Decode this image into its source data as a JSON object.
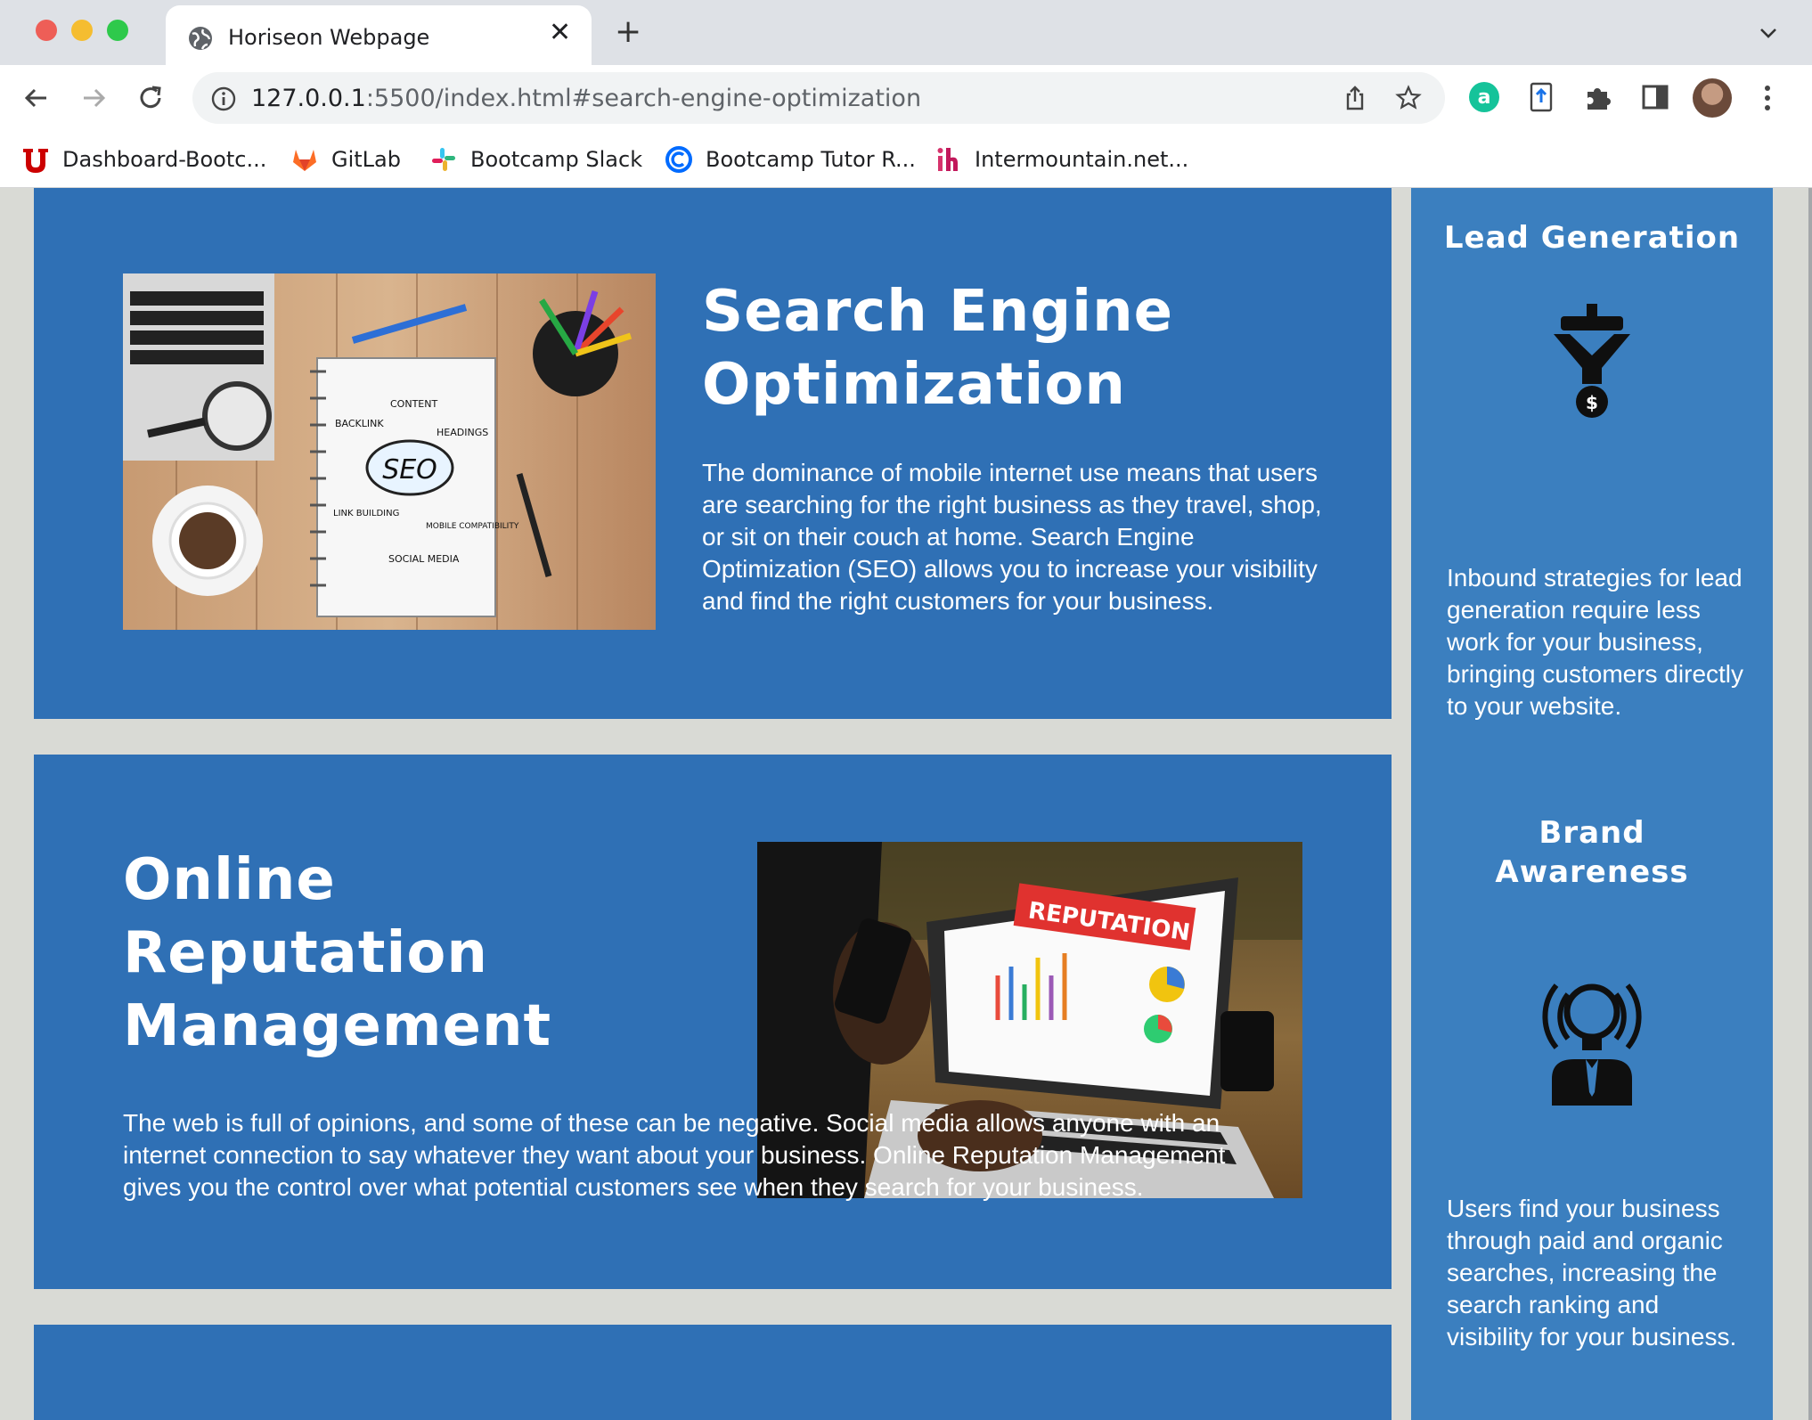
{
  "browser": {
    "tab_title": "Horiseon Webpage",
    "url_host": "127.0.0.1",
    "url_rest": ":5500/index.html#search-engine-optimization",
    "bookmarks": [
      {
        "label": "Dashboard-Bootc...",
        "icon": "university-logo-icon"
      },
      {
        "label": "GitLab",
        "icon": "gitlab-icon"
      },
      {
        "label": "Bootcamp Slack",
        "icon": "slack-icon"
      },
      {
        "label": "Bootcamp Tutor R...",
        "icon": "calendly-icon"
      },
      {
        "label": "Intermountain.net...",
        "icon": "intermountain-icon"
      }
    ]
  },
  "sections": {
    "seo": {
      "title": "Search Engine Optimization",
      "text": "The dominance of mobile internet use means that users are searching for the right business as they travel, shop, or sit on their couch at home. Search Engine Optimization (SEO) allows you to increase your visibility and find the right customers for your business.",
      "image_labels": {
        "center": "SEO",
        "content": "CONTENT",
        "backlink": "BACKLINK",
        "headings": "HEADINGS",
        "link_building": "LINK BUILDING",
        "mobile": "MOBILE COMPATIBILITY",
        "social": "SOCIAL MEDIA"
      }
    },
    "orm": {
      "title": "Online Reputation Management",
      "text": "The web is full of opinions, and some of these can be negative. Social media allows anyone with an internet connection to say whatever they want about your business. Online Reputation Management gives you the control over what potential customers see when they search for your business.",
      "image_label": "REPUTATION"
    }
  },
  "sidebar": {
    "lead": {
      "title": "Lead Generation",
      "text": "Inbound strategies for lead generation require less work for your business, bringing customers directly to your website.",
      "icon": "lead-generation-icon"
    },
    "brand": {
      "title": "Brand Awareness",
      "text": "Users find your business through paid and organic searches, increasing the search ranking and visibility for your business.",
      "icon": "brand-awareness-icon"
    }
  },
  "colors": {
    "card_blue": "#2f70b5",
    "sidebar_blue": "#3b7fbf",
    "page_bg": "#d9dad5"
  }
}
